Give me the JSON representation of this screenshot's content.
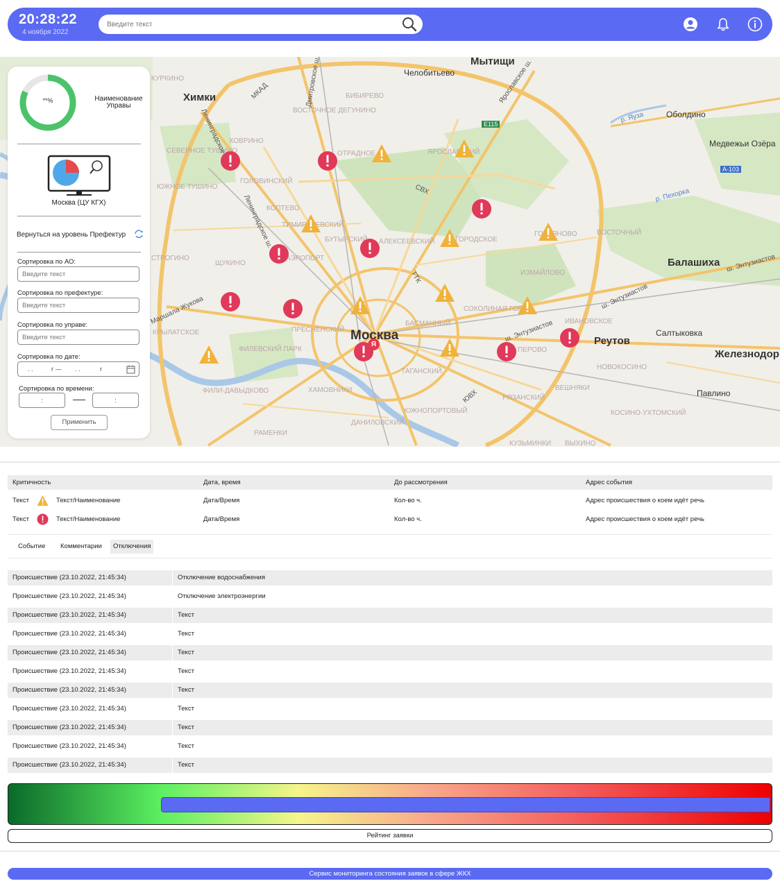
{
  "header": {
    "time": "20:28:22",
    "date": "4 ноября 2022",
    "search_placeholder": "Введите текст"
  },
  "map": {
    "districts": [
      "КУРКИНО",
      "СЕВЕРНОЕ ТУШИНО",
      "ЮЖНОЕ ТУШИНО",
      "ХОВРИНО",
      "ГОЛОВИНСКИЙ",
      "КОПТЕВО",
      "ВОСТОЧНОЕ ДЕГУНИНО",
      "БИБИРЕВО",
      "ОТРАДНОЕ",
      "ЯРОСЛАВСКИЙ",
      "ТИМИРЯЗЕВСКИЙ",
      "БУТЫРСКИЙ",
      "АЛЕКСЕЕВСКИЙ",
      "ГОРОДСКОЕ",
      "ГОЛЬЯНОВО",
      "ВОСТОЧНЫЙ",
      "ИЗМАЙЛОВО",
      "ЩУКИНО",
      "АЭРОПОРТ",
      "ПРЕСНЕНСКИЙ",
      "БАСМАННЫЙ",
      "СОКОЛИНАЯ ГОРА",
      "ИВАНОВСКОЕ",
      "ПЕРОВО",
      "НОВОКОСИНО",
      "ВЕШНЯКИ",
      "ТАГАНСКИЙ",
      "ХАМОВНИКИ",
      "ФИЛЕВСКИЙ ПАРК",
      "ФИЛИ-ДАВЫДКОВО",
      "ДАНИЛОВСКИЙ",
      "ЮЖНОПОРТОВЫЙ",
      "РЯЗАНСКИЙ",
      "КОСИНО-УХТОМСКИЙ",
      "РАМЕНКИ",
      "КУЗЬМИНКИ",
      "ВЫХИНО",
      "КРЫЛАТСКОЕ",
      "СТРОГИНО"
    ],
    "cities": [
      "Мытищи",
      "Челобитьево",
      "Химки",
      "Оболдино",
      "Медвежьи Озёра",
      "Балашиха",
      "Реутов",
      "Салтыковка",
      "Железнодор",
      "Павлино",
      "Москва"
    ],
    "roads": [
      "МКАД",
      "ТТК",
      "СВХ",
      "ЮВХ",
      "Ярославское ш.",
      "Дмитровское ш.",
      "Ленинградское ш.",
      "Ленинградское ш.",
      "ш. Энтузиастов",
      "ш. Энтузиастов",
      "ш. Энтузиастов",
      "Маршала Жукова",
      "р. Яуза",
      "р. Пехорка",
      "E115",
      "A-103",
      "Я"
    ]
  },
  "panel": {
    "gauge_value": "**%",
    "gauge_fraction": 0.82,
    "uprava_label": "Наименование Управы",
    "monitor_label": "Москва (ЦУ КГХ)",
    "back_label": "Вернуться на уровень Префектур",
    "filters": [
      {
        "label": "Сортировка по АО:",
        "placeholder": "Введите текст"
      },
      {
        "label": "Сортировка по префектуре:",
        "placeholder": "Введите текст"
      },
      {
        "label": "Сортировка по управе:",
        "placeholder": "Введите текст"
      }
    ],
    "date_label": "Сортировка по дате:",
    "date_parts": [
      ". .",
      "г —",
      ". .",
      "г"
    ],
    "time_label": "Сортировка по времени:",
    "time_from": ":",
    "time_to": ":",
    "apply_label": "Применить"
  },
  "criticality_table": {
    "headers": [
      "Критичность",
      "Дата, время",
      "До рассмотрения",
      "Адрес события"
    ],
    "rows": [
      {
        "level": "Текст",
        "icon": "warning-icon",
        "name": "Текст/Наименование",
        "datetime": "Дата/Время",
        "remaining": "Кол-во ч.",
        "address": "Адрес происшествия о коем идёт речь"
      },
      {
        "level": "Текст",
        "icon": "alert-icon",
        "name": "Текст/Наименование",
        "datetime": "Дата/Время",
        "remaining": "Кол-во ч.",
        "address": "Адрес происшествия о коем идёт речь"
      }
    ]
  },
  "tabs": [
    {
      "label": "Событие",
      "active": false
    },
    {
      "label": "Комментарии",
      "active": false
    },
    {
      "label": "Отключения",
      "active": true
    }
  ],
  "incidents": [
    {
      "event": "Происшествие (23.10.2022, 21:45:34)",
      "text": "Отключение водоснабжения"
    },
    {
      "event": "Происшествие (23.10.2022, 21:45:34)",
      "text": "Отключение электроэнергии"
    },
    {
      "event": "Происшествие (23.10.2022, 21:45:34)",
      "text": "Текст"
    },
    {
      "event": "Происшествие (23.10.2022, 21:45:34)",
      "text": "Текст"
    },
    {
      "event": "Происшествие (23.10.2022, 21:45:34)",
      "text": "Текст"
    },
    {
      "event": "Происшествие (23.10.2022, 21:45:34)",
      "text": "Текст"
    },
    {
      "event": "Происшествие (23.10.2022, 21:45:34)",
      "text": "Текст"
    },
    {
      "event": "Происшествие (23.10.2022, 21:45:34)",
      "text": "Текст"
    },
    {
      "event": "Происшествие (23.10.2022, 21:45:34)",
      "text": "Текст"
    },
    {
      "event": "Происшествие (23.10.2022, 21:45:34)",
      "text": "Текст"
    },
    {
      "event": "Происшествие (23.10.2022, 21:45:34)",
      "text": "Текст"
    }
  ],
  "rating": {
    "label": "Рейтинг заявки",
    "value_fraction": 0.2
  },
  "footer": "Сервис мониторинга состояния заявок в сфере ЖКХ",
  "colors": {
    "accent": "#5b6af2",
    "alert": "#e0395a",
    "warning": "#f0b23a",
    "gauge": "#4cc36a"
  }
}
